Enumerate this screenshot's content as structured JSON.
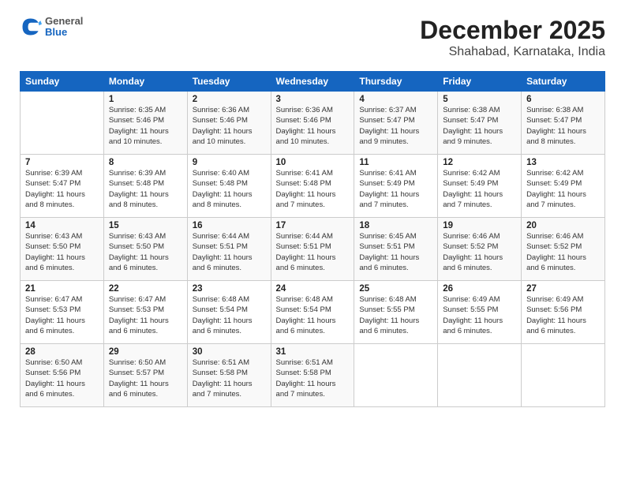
{
  "header": {
    "logo_general": "General",
    "logo_blue": "Blue",
    "month_year": "December 2025",
    "location": "Shahabad, Karnataka, India"
  },
  "days_of_week": [
    "Sunday",
    "Monday",
    "Tuesday",
    "Wednesday",
    "Thursday",
    "Friday",
    "Saturday"
  ],
  "weeks": [
    [
      {
        "day": "",
        "info": ""
      },
      {
        "day": "1",
        "info": "Sunrise: 6:35 AM\nSunset: 5:46 PM\nDaylight: 11 hours and 10 minutes."
      },
      {
        "day": "2",
        "info": "Sunrise: 6:36 AM\nSunset: 5:46 PM\nDaylight: 11 hours and 10 minutes."
      },
      {
        "day": "3",
        "info": "Sunrise: 6:36 AM\nSunset: 5:46 PM\nDaylight: 11 hours and 10 minutes."
      },
      {
        "day": "4",
        "info": "Sunrise: 6:37 AM\nSunset: 5:47 PM\nDaylight: 11 hours and 9 minutes."
      },
      {
        "day": "5",
        "info": "Sunrise: 6:38 AM\nSunset: 5:47 PM\nDaylight: 11 hours and 9 minutes."
      },
      {
        "day": "6",
        "info": "Sunrise: 6:38 AM\nSunset: 5:47 PM\nDaylight: 11 hours and 8 minutes."
      }
    ],
    [
      {
        "day": "7",
        "info": "Sunrise: 6:39 AM\nSunset: 5:47 PM\nDaylight: 11 hours and 8 minutes."
      },
      {
        "day": "8",
        "info": "Sunrise: 6:39 AM\nSunset: 5:48 PM\nDaylight: 11 hours and 8 minutes."
      },
      {
        "day": "9",
        "info": "Sunrise: 6:40 AM\nSunset: 5:48 PM\nDaylight: 11 hours and 8 minutes."
      },
      {
        "day": "10",
        "info": "Sunrise: 6:41 AM\nSunset: 5:48 PM\nDaylight: 11 hours and 7 minutes."
      },
      {
        "day": "11",
        "info": "Sunrise: 6:41 AM\nSunset: 5:49 PM\nDaylight: 11 hours and 7 minutes."
      },
      {
        "day": "12",
        "info": "Sunrise: 6:42 AM\nSunset: 5:49 PM\nDaylight: 11 hours and 7 minutes."
      },
      {
        "day": "13",
        "info": "Sunrise: 6:42 AM\nSunset: 5:49 PM\nDaylight: 11 hours and 7 minutes."
      }
    ],
    [
      {
        "day": "14",
        "info": "Sunrise: 6:43 AM\nSunset: 5:50 PM\nDaylight: 11 hours and 6 minutes."
      },
      {
        "day": "15",
        "info": "Sunrise: 6:43 AM\nSunset: 5:50 PM\nDaylight: 11 hours and 6 minutes."
      },
      {
        "day": "16",
        "info": "Sunrise: 6:44 AM\nSunset: 5:51 PM\nDaylight: 11 hours and 6 minutes."
      },
      {
        "day": "17",
        "info": "Sunrise: 6:44 AM\nSunset: 5:51 PM\nDaylight: 11 hours and 6 minutes."
      },
      {
        "day": "18",
        "info": "Sunrise: 6:45 AM\nSunset: 5:51 PM\nDaylight: 11 hours and 6 minutes."
      },
      {
        "day": "19",
        "info": "Sunrise: 6:46 AM\nSunset: 5:52 PM\nDaylight: 11 hours and 6 minutes."
      },
      {
        "day": "20",
        "info": "Sunrise: 6:46 AM\nSunset: 5:52 PM\nDaylight: 11 hours and 6 minutes."
      }
    ],
    [
      {
        "day": "21",
        "info": "Sunrise: 6:47 AM\nSunset: 5:53 PM\nDaylight: 11 hours and 6 minutes."
      },
      {
        "day": "22",
        "info": "Sunrise: 6:47 AM\nSunset: 5:53 PM\nDaylight: 11 hours and 6 minutes."
      },
      {
        "day": "23",
        "info": "Sunrise: 6:48 AM\nSunset: 5:54 PM\nDaylight: 11 hours and 6 minutes."
      },
      {
        "day": "24",
        "info": "Sunrise: 6:48 AM\nSunset: 5:54 PM\nDaylight: 11 hours and 6 minutes."
      },
      {
        "day": "25",
        "info": "Sunrise: 6:48 AM\nSunset: 5:55 PM\nDaylight: 11 hours and 6 minutes."
      },
      {
        "day": "26",
        "info": "Sunrise: 6:49 AM\nSunset: 5:55 PM\nDaylight: 11 hours and 6 minutes."
      },
      {
        "day": "27",
        "info": "Sunrise: 6:49 AM\nSunset: 5:56 PM\nDaylight: 11 hours and 6 minutes."
      }
    ],
    [
      {
        "day": "28",
        "info": "Sunrise: 6:50 AM\nSunset: 5:56 PM\nDaylight: 11 hours and 6 minutes."
      },
      {
        "day": "29",
        "info": "Sunrise: 6:50 AM\nSunset: 5:57 PM\nDaylight: 11 hours and 6 minutes."
      },
      {
        "day": "30",
        "info": "Sunrise: 6:51 AM\nSunset: 5:58 PM\nDaylight: 11 hours and 7 minutes."
      },
      {
        "day": "31",
        "info": "Sunrise: 6:51 AM\nSunset: 5:58 PM\nDaylight: 11 hours and 7 minutes."
      },
      {
        "day": "",
        "info": ""
      },
      {
        "day": "",
        "info": ""
      },
      {
        "day": "",
        "info": ""
      }
    ]
  ]
}
